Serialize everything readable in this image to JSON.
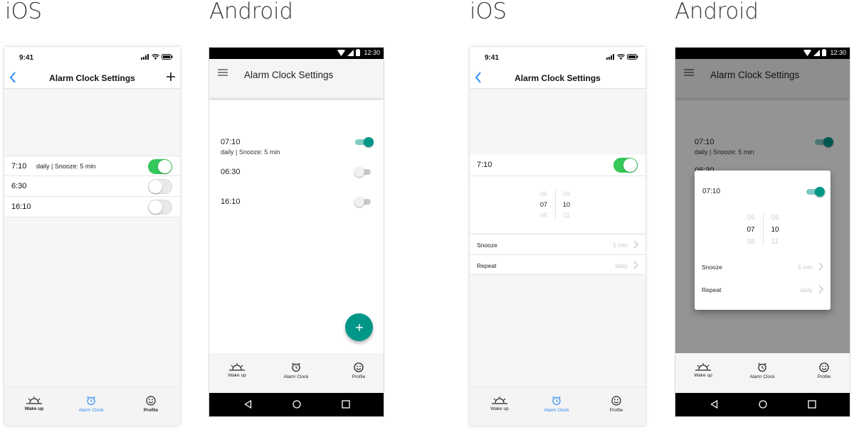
{
  "labels": {
    "ios_left": "iOS",
    "android_left": "Android",
    "ios_right": "iOS",
    "android_right": "Android"
  },
  "ios_status_time": "9:41",
  "android_status_time": "12:30",
  "title": "Alarm Clock Settings",
  "ios_list": {
    "alarms": [
      {
        "time": "7:10",
        "sub": "daily | Snooze: 5 min",
        "enabled": true
      },
      {
        "time": "6:30",
        "sub": "",
        "enabled": false
      },
      {
        "time": "16:10",
        "sub": "",
        "enabled": false
      }
    ]
  },
  "android_list": {
    "alarms": [
      {
        "time": "07:10",
        "sub": "daily | Snooze: 5 min",
        "enabled": true
      },
      {
        "time": "06:30",
        "sub": "",
        "enabled": false
      },
      {
        "time": "16:10",
        "sub": "",
        "enabled": false
      }
    ],
    "fab_icon": "plus-icon"
  },
  "ios_edit": {
    "alarm_time": "7:10",
    "enabled": true,
    "hour_column": [
      "06",
      "07",
      "08"
    ],
    "minute_column": [
      "09",
      "10",
      "11"
    ],
    "snooze_label": "Snooze",
    "snooze_value": "5 min",
    "repeat_label": "Repeat",
    "repeat_value": "daily"
  },
  "android_edit": {
    "background_alarm": {
      "time": "07:10",
      "sub": "daily | Snooze: 5 min",
      "partial_time": "06:30"
    },
    "dialog_time": "07:10",
    "enabled": true,
    "hour_column": [
      "06",
      "07",
      "08"
    ],
    "minute_column": [
      "09",
      "10",
      "11"
    ],
    "snooze_label": "Snooze",
    "snooze_value": "5 min",
    "repeat_label": "Repeat",
    "repeat_value": "daily"
  },
  "tabs": [
    {
      "label": "Wake up",
      "icon": "sunrise-icon"
    },
    {
      "label": "Alarm Clock",
      "icon": "alarm-clock-icon"
    },
    {
      "label": "Profile",
      "icon": "smiley-icon"
    }
  ],
  "colors": {
    "ios_green": "#34c759",
    "ios_blue": "#2d8cf0",
    "android_teal": "#009688"
  }
}
